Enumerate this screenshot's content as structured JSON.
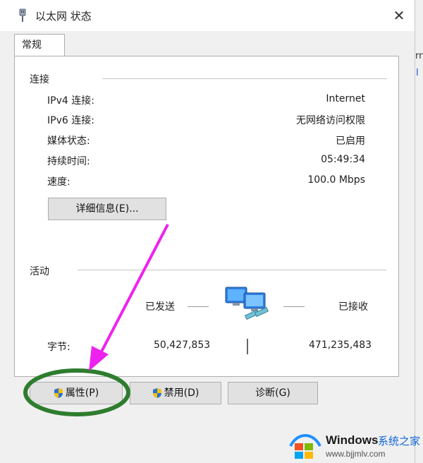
{
  "window": {
    "title": "以太网 状态",
    "close_glyph": "✕"
  },
  "tabs": [
    {
      "label": "常规"
    }
  ],
  "connection": {
    "heading": "连接",
    "rows": [
      {
        "label": "IPv4 连接:",
        "value": "Internet"
      },
      {
        "label": "IPv6 连接:",
        "value": "无网络访问权限"
      },
      {
        "label": "媒体状态:",
        "value": "已启用"
      },
      {
        "label": "持续时间:",
        "value": "05:49:34"
      },
      {
        "label": "速度:",
        "value": "100.0 Mbps"
      }
    ],
    "details_button": "详细信息(E)..."
  },
  "activity": {
    "heading": "活动",
    "sent_label": "已发送",
    "received_label": "已接收",
    "bytes_label": "字节:",
    "bytes_sent": "50,427,853",
    "bytes_received": "471,235,483"
  },
  "buttons": {
    "properties": "属性(P)",
    "disable": "禁用(D)",
    "diagnose": "诊断(G)"
  },
  "background": {
    "fragments": [
      "rr",
      "l"
    ]
  },
  "watermark": {
    "brand": "Windows",
    "site": "系统之家",
    "url": "www.bjjmlv.com"
  },
  "colors": {
    "annotation_arrow": "#ee22ee",
    "annotation_circle": "#2e7d2e",
    "shield_blue": "#2b6fd6",
    "shield_yellow": "#f2c200"
  }
}
